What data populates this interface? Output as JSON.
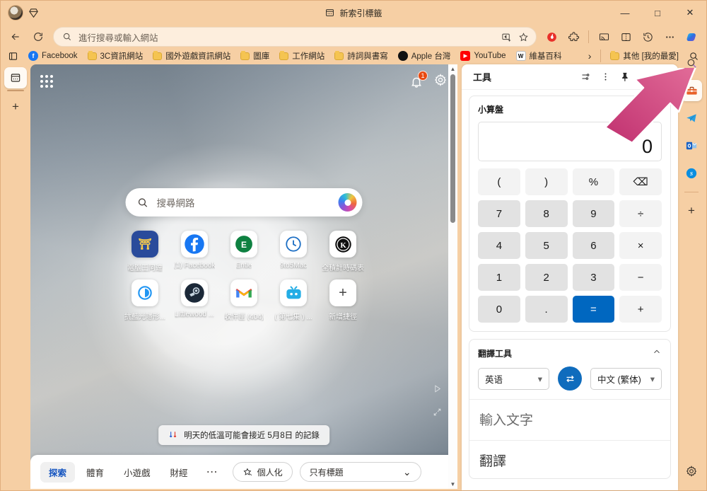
{
  "window": {
    "tab_title": "新索引標籤",
    "minimize": "—",
    "maximize": "□",
    "close": "✕"
  },
  "navigation": {
    "back": "←",
    "refresh": "⟳",
    "address_value": "進行搜尋或輸入網站",
    "read_aloud_icon": "image-creator-icon",
    "favorite_icon": "star-icon"
  },
  "toolbar_right": {
    "items": [
      {
        "name": "shield-flame-icon",
        "glyph": "🛡"
      },
      {
        "name": "extensions-icon",
        "glyph": "🧩"
      },
      {
        "name": "cast-icon",
        "glyph": "📶"
      },
      {
        "name": "split-screen-icon",
        "glyph": "⫿⫿"
      },
      {
        "name": "history-icon",
        "glyph": "🕘"
      },
      {
        "name": "more-settings-icon",
        "glyph": "⋯"
      },
      {
        "name": "copilot-icon",
        "glyph": "✦"
      }
    ]
  },
  "bookmarks": {
    "collections_icon": "collections-icon",
    "overflow": "›",
    "other_label": "其他 [我的最愛]",
    "search_icon": "search-icon",
    "items": [
      {
        "label": "Facebook",
        "type": "site",
        "color": "#1877f2",
        "glyph": "f"
      },
      {
        "label": "3C資訊網站",
        "type": "folder"
      },
      {
        "label": "國外遊戲資訊網站",
        "type": "folder"
      },
      {
        "label": "圖庫",
        "type": "folder"
      },
      {
        "label": "工作網站",
        "type": "folder"
      },
      {
        "label": "詩詞與書寫",
        "type": "folder"
      },
      {
        "label": "Apple 台灣",
        "type": "site",
        "color": "#111111",
        "glyph": ""
      },
      {
        "label": "YouTube",
        "type": "site",
        "color": "#ff0000",
        "glyph": "▶"
      },
      {
        "label": "維基百科",
        "type": "site",
        "color": "#ffffff",
        "glyph": "W"
      }
    ]
  },
  "tab_rail": {
    "active_tab_icon": "new-tab-page-icon",
    "add_tab": "+"
  },
  "new_tab_page": {
    "apps_grid_icon": "apps-grid-icon",
    "notification_badge": "1",
    "settings_icon": "gear-icon",
    "search_placeholder": "搜尋網路",
    "search_icon": "search-icon",
    "copilot_icon": "copilot-icon",
    "shortcuts": [
      {
        "label": "電腦王阿達",
        "glyph": "⛩",
        "bg": "#2a4b9b",
        "fg": "#ffd04a"
      },
      {
        "label": "(1) Facebook",
        "glyph": "f",
        "bg": "#1877f2",
        "fg": "#ffffff"
      },
      {
        "label": "Entie",
        "glyph": "E",
        "bg": "#0e8141",
        "fg": "#ffffff"
      },
      {
        "label": "9to5Mac",
        "glyph": "🕐",
        "bg": "#ffffff",
        "fg": "#1d6fc4"
      },
      {
        "label": "全積計時碼表",
        "glyph": "Ⓚ",
        "bg": "#ffffff",
        "fg": "#111111"
      },
      {
        "label": "抗藍光隱形...",
        "glyph": "◎",
        "bg": "#ffffff",
        "fg": "#2196f3"
      },
      {
        "label": "Littlewood ...",
        "glyph": "◉",
        "bg": "#1b2838",
        "fg": "#c7d5e0"
      },
      {
        "label": "收件匣 (404)",
        "glyph": "M",
        "bg": "#ffffff",
        "fg": "#ea4335"
      },
      {
        "label": "( 第七集 ) ...",
        "glyph": "📺",
        "bg": "#ffffff",
        "fg": "#23ade5"
      },
      {
        "label": "新增捷徑",
        "glyph": "+",
        "bg": "#ffffff",
        "fg": "#333333"
      }
    ],
    "weather_tip": "明天的低溫可能會接近 5月8日 的記錄",
    "weather_icon": "temperature-down-icon",
    "feed_tabs": [
      {
        "label": "探索",
        "active": true
      },
      {
        "label": "體育",
        "active": false
      },
      {
        "label": "小遊戲",
        "active": false
      },
      {
        "label": "財經",
        "active": false
      }
    ],
    "feed_more": "⋯",
    "personalize_label": "個人化",
    "personalize_icon": "magic-star-icon",
    "headlines_label": "只有標題",
    "headlines_chevron": "⌄",
    "play_icon": "play-triangle-icon",
    "expand_icon": "expand-arrows-icon"
  },
  "panel": {
    "title": "工具",
    "header_icons": [
      {
        "name": "tuning-sliders-icon",
        "glyph": "⇄"
      },
      {
        "name": "more-vertical-icon",
        "glyph": "⋮"
      },
      {
        "name": "pin-icon",
        "glyph": "📌"
      },
      {
        "name": "minimize-icon",
        "glyph": "—"
      },
      {
        "name": "collapse-chevron-icon",
        "glyph": "⌄"
      }
    ],
    "calculator": {
      "title": "小算盤",
      "display": "0",
      "keys": [
        {
          "label": "(",
          "style": "light"
        },
        {
          "label": ")",
          "style": "light"
        },
        {
          "label": "%",
          "style": "light"
        },
        {
          "label": "⌫",
          "style": "light"
        },
        {
          "label": "7",
          "style": "num"
        },
        {
          "label": "8",
          "style": "num"
        },
        {
          "label": "9",
          "style": "num"
        },
        {
          "label": "÷",
          "style": "light"
        },
        {
          "label": "4",
          "style": "num"
        },
        {
          "label": "5",
          "style": "num"
        },
        {
          "label": "6",
          "style": "num"
        },
        {
          "label": "×",
          "style": "light"
        },
        {
          "label": "1",
          "style": "num"
        },
        {
          "label": "2",
          "style": "num"
        },
        {
          "label": "3",
          "style": "num"
        },
        {
          "label": "−",
          "style": "light"
        },
        {
          "label": "0",
          "style": "num"
        },
        {
          "label": ".",
          "style": "num"
        },
        {
          "label": "=",
          "style": "eq"
        },
        {
          "label": "+",
          "style": "light"
        }
      ]
    },
    "translator": {
      "title": "翻譯工具",
      "collapse_icon": "chevron-up-icon",
      "source_lang": "英语",
      "target_lang": "中文 (繁体)",
      "swap_icon": "swap-arrows-icon",
      "chevron": "▾",
      "input_placeholder": "輸入文字",
      "output_label": "翻譯"
    }
  },
  "edge_sidebar": {
    "items": [
      {
        "name": "search-icon",
        "glyph": "🔍",
        "selected": false
      },
      {
        "name": "tools-toolbox-icon",
        "glyph": "🧰",
        "selected": true
      },
      {
        "name": "telegram-icon",
        "glyph": "➤",
        "selected": false
      },
      {
        "name": "outlook-icon",
        "glyph": "O",
        "selected": false
      },
      {
        "name": "skype-icon",
        "glyph": "S",
        "selected": false
      }
    ],
    "add_icon": "+",
    "settings_icon": "gear-icon"
  }
}
